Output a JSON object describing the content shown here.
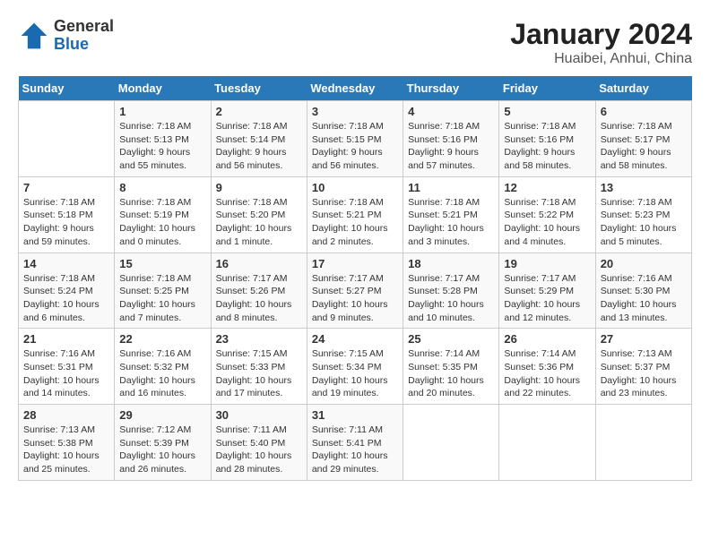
{
  "header": {
    "logo_general": "General",
    "logo_blue": "Blue",
    "title": "January 2024",
    "subtitle": "Huaibei, Anhui, China"
  },
  "weekdays": [
    "Sunday",
    "Monday",
    "Tuesday",
    "Wednesday",
    "Thursday",
    "Friday",
    "Saturday"
  ],
  "weeks": [
    [
      {
        "day": "",
        "sunrise": "",
        "sunset": "",
        "daylight": ""
      },
      {
        "day": "1",
        "sunrise": "Sunrise: 7:18 AM",
        "sunset": "Sunset: 5:13 PM",
        "daylight": "Daylight: 9 hours and 55 minutes."
      },
      {
        "day": "2",
        "sunrise": "Sunrise: 7:18 AM",
        "sunset": "Sunset: 5:14 PM",
        "daylight": "Daylight: 9 hours and 56 minutes."
      },
      {
        "day": "3",
        "sunrise": "Sunrise: 7:18 AM",
        "sunset": "Sunset: 5:15 PM",
        "daylight": "Daylight: 9 hours and 56 minutes."
      },
      {
        "day": "4",
        "sunrise": "Sunrise: 7:18 AM",
        "sunset": "Sunset: 5:16 PM",
        "daylight": "Daylight: 9 hours and 57 minutes."
      },
      {
        "day": "5",
        "sunrise": "Sunrise: 7:18 AM",
        "sunset": "Sunset: 5:16 PM",
        "daylight": "Daylight: 9 hours and 58 minutes."
      },
      {
        "day": "6",
        "sunrise": "Sunrise: 7:18 AM",
        "sunset": "Sunset: 5:17 PM",
        "daylight": "Daylight: 9 hours and 58 minutes."
      }
    ],
    [
      {
        "day": "7",
        "sunrise": "Sunrise: 7:18 AM",
        "sunset": "Sunset: 5:18 PM",
        "daylight": "Daylight: 9 hours and 59 minutes."
      },
      {
        "day": "8",
        "sunrise": "Sunrise: 7:18 AM",
        "sunset": "Sunset: 5:19 PM",
        "daylight": "Daylight: 10 hours and 0 minutes."
      },
      {
        "day": "9",
        "sunrise": "Sunrise: 7:18 AM",
        "sunset": "Sunset: 5:20 PM",
        "daylight": "Daylight: 10 hours and 1 minute."
      },
      {
        "day": "10",
        "sunrise": "Sunrise: 7:18 AM",
        "sunset": "Sunset: 5:21 PM",
        "daylight": "Daylight: 10 hours and 2 minutes."
      },
      {
        "day": "11",
        "sunrise": "Sunrise: 7:18 AM",
        "sunset": "Sunset: 5:21 PM",
        "daylight": "Daylight: 10 hours and 3 minutes."
      },
      {
        "day": "12",
        "sunrise": "Sunrise: 7:18 AM",
        "sunset": "Sunset: 5:22 PM",
        "daylight": "Daylight: 10 hours and 4 minutes."
      },
      {
        "day": "13",
        "sunrise": "Sunrise: 7:18 AM",
        "sunset": "Sunset: 5:23 PM",
        "daylight": "Daylight: 10 hours and 5 minutes."
      }
    ],
    [
      {
        "day": "14",
        "sunrise": "Sunrise: 7:18 AM",
        "sunset": "Sunset: 5:24 PM",
        "daylight": "Daylight: 10 hours and 6 minutes."
      },
      {
        "day": "15",
        "sunrise": "Sunrise: 7:18 AM",
        "sunset": "Sunset: 5:25 PM",
        "daylight": "Daylight: 10 hours and 7 minutes."
      },
      {
        "day": "16",
        "sunrise": "Sunrise: 7:17 AM",
        "sunset": "Sunset: 5:26 PM",
        "daylight": "Daylight: 10 hours and 8 minutes."
      },
      {
        "day": "17",
        "sunrise": "Sunrise: 7:17 AM",
        "sunset": "Sunset: 5:27 PM",
        "daylight": "Daylight: 10 hours and 9 minutes."
      },
      {
        "day": "18",
        "sunrise": "Sunrise: 7:17 AM",
        "sunset": "Sunset: 5:28 PM",
        "daylight": "Daylight: 10 hours and 10 minutes."
      },
      {
        "day": "19",
        "sunrise": "Sunrise: 7:17 AM",
        "sunset": "Sunset: 5:29 PM",
        "daylight": "Daylight: 10 hours and 12 minutes."
      },
      {
        "day": "20",
        "sunrise": "Sunrise: 7:16 AM",
        "sunset": "Sunset: 5:30 PM",
        "daylight": "Daylight: 10 hours and 13 minutes."
      }
    ],
    [
      {
        "day": "21",
        "sunrise": "Sunrise: 7:16 AM",
        "sunset": "Sunset: 5:31 PM",
        "daylight": "Daylight: 10 hours and 14 minutes."
      },
      {
        "day": "22",
        "sunrise": "Sunrise: 7:16 AM",
        "sunset": "Sunset: 5:32 PM",
        "daylight": "Daylight: 10 hours and 16 minutes."
      },
      {
        "day": "23",
        "sunrise": "Sunrise: 7:15 AM",
        "sunset": "Sunset: 5:33 PM",
        "daylight": "Daylight: 10 hours and 17 minutes."
      },
      {
        "day": "24",
        "sunrise": "Sunrise: 7:15 AM",
        "sunset": "Sunset: 5:34 PM",
        "daylight": "Daylight: 10 hours and 19 minutes."
      },
      {
        "day": "25",
        "sunrise": "Sunrise: 7:14 AM",
        "sunset": "Sunset: 5:35 PM",
        "daylight": "Daylight: 10 hours and 20 minutes."
      },
      {
        "day": "26",
        "sunrise": "Sunrise: 7:14 AM",
        "sunset": "Sunset: 5:36 PM",
        "daylight": "Daylight: 10 hours and 22 minutes."
      },
      {
        "day": "27",
        "sunrise": "Sunrise: 7:13 AM",
        "sunset": "Sunset: 5:37 PM",
        "daylight": "Daylight: 10 hours and 23 minutes."
      }
    ],
    [
      {
        "day": "28",
        "sunrise": "Sunrise: 7:13 AM",
        "sunset": "Sunset: 5:38 PM",
        "daylight": "Daylight: 10 hours and 25 minutes."
      },
      {
        "day": "29",
        "sunrise": "Sunrise: 7:12 AM",
        "sunset": "Sunset: 5:39 PM",
        "daylight": "Daylight: 10 hours and 26 minutes."
      },
      {
        "day": "30",
        "sunrise": "Sunrise: 7:11 AM",
        "sunset": "Sunset: 5:40 PM",
        "daylight": "Daylight: 10 hours and 28 minutes."
      },
      {
        "day": "31",
        "sunrise": "Sunrise: 7:11 AM",
        "sunset": "Sunset: 5:41 PM",
        "daylight": "Daylight: 10 hours and 29 minutes."
      },
      {
        "day": "",
        "sunrise": "",
        "sunset": "",
        "daylight": ""
      },
      {
        "day": "",
        "sunrise": "",
        "sunset": "",
        "daylight": ""
      },
      {
        "day": "",
        "sunrise": "",
        "sunset": "",
        "daylight": ""
      }
    ]
  ]
}
